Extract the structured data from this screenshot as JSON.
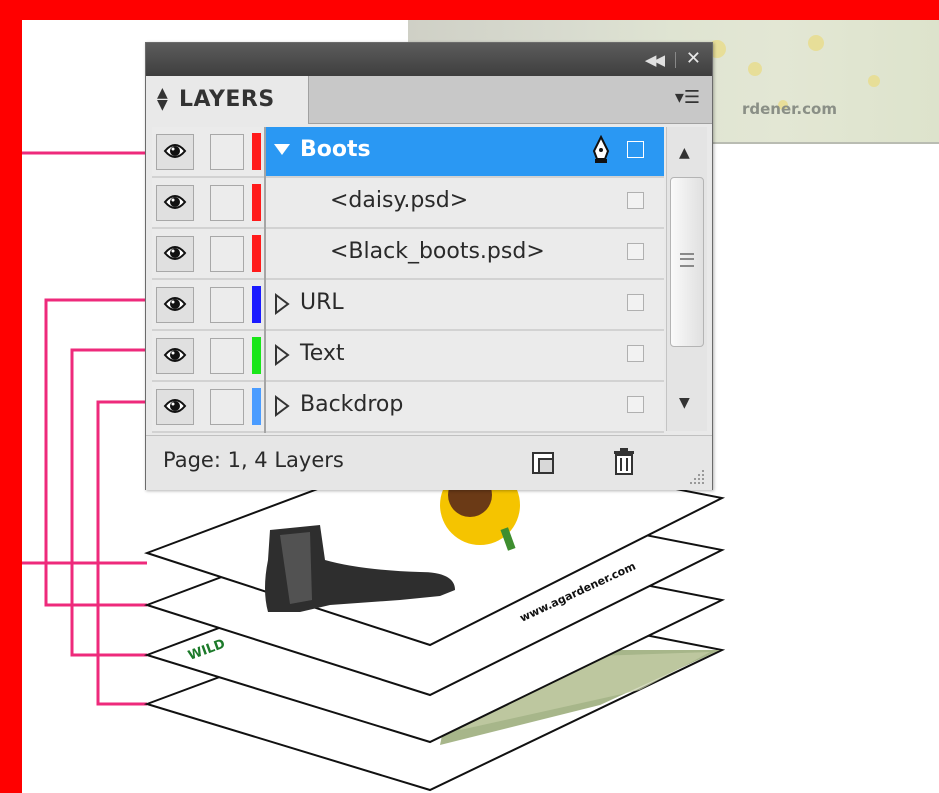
{
  "panel": {
    "tab_label": "LAYERS",
    "layers": [
      {
        "name": "Boots",
        "color": "#ff1a1a",
        "selected": true,
        "expanded": true,
        "indent": false
      },
      {
        "name": "<daisy.psd>",
        "color": "#ff1a1a",
        "selected": false,
        "expanded": null,
        "indent": true
      },
      {
        "name": "<Black_boots.psd>",
        "color": "#ff1a1a",
        "selected": false,
        "expanded": null,
        "indent": true
      },
      {
        "name": "URL",
        "color": "#1a1aff",
        "selected": false,
        "expanded": false,
        "indent": false
      },
      {
        "name": "Text",
        "color": "#19e619",
        "selected": false,
        "expanded": false,
        "indent": false
      },
      {
        "name": "Backdrop",
        "color": "#4a9cff",
        "selected": false,
        "expanded": false,
        "indent": false
      }
    ],
    "status": "Page: 1, 4 Layers"
  },
  "background": {
    "url_fragment": "rdener.com",
    "frame_color": "#ff0000",
    "connector_color": "#ee2a7b",
    "selection_color": "#2a98f3"
  },
  "illustration": {
    "url_text": "www.agardener.com",
    "title_fragment": "WILD"
  },
  "icons": [
    "eye-icon",
    "pen-icon",
    "new-layer-icon",
    "trash-icon",
    "collapse-icon",
    "close-icon",
    "panel-menu-icon"
  ]
}
